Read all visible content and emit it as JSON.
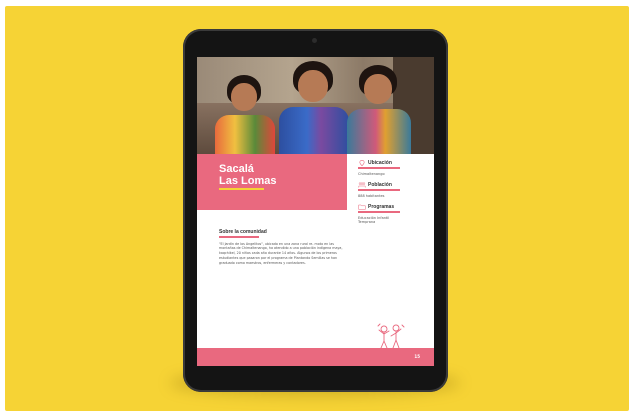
{
  "page": {
    "title": "Sacalá\nLas Lomas",
    "sidebar": [
      {
        "icon": "location-pin-icon",
        "label": "Ubicación",
        "value": "Chimaltenango"
      },
      {
        "icon": "people-icon",
        "label": "Población",
        "value": "888 habitantes"
      },
      {
        "icon": "folder-icon",
        "label": "Programas",
        "value": "Educación Infantil\nTemprana"
      }
    ],
    "about": {
      "heading": "Sobre la comunidad",
      "body": "\"El Jardín de los Angelitos\", ubicado en una zona rural re- moto en las montañas de Chimaltenango, ha atendido a una población indígena maya, kaqchikel, 20 niños cada año durante 14 años. Algunos de los primeros estudiantes que pasaron por el programa de Plantando Semillas se han graduado como maestros, enfermeras y contadores."
    },
    "page_number": "15"
  },
  "colors": {
    "background": "#f6d335",
    "accent": "#e9697f",
    "underline": "#f6d335"
  }
}
